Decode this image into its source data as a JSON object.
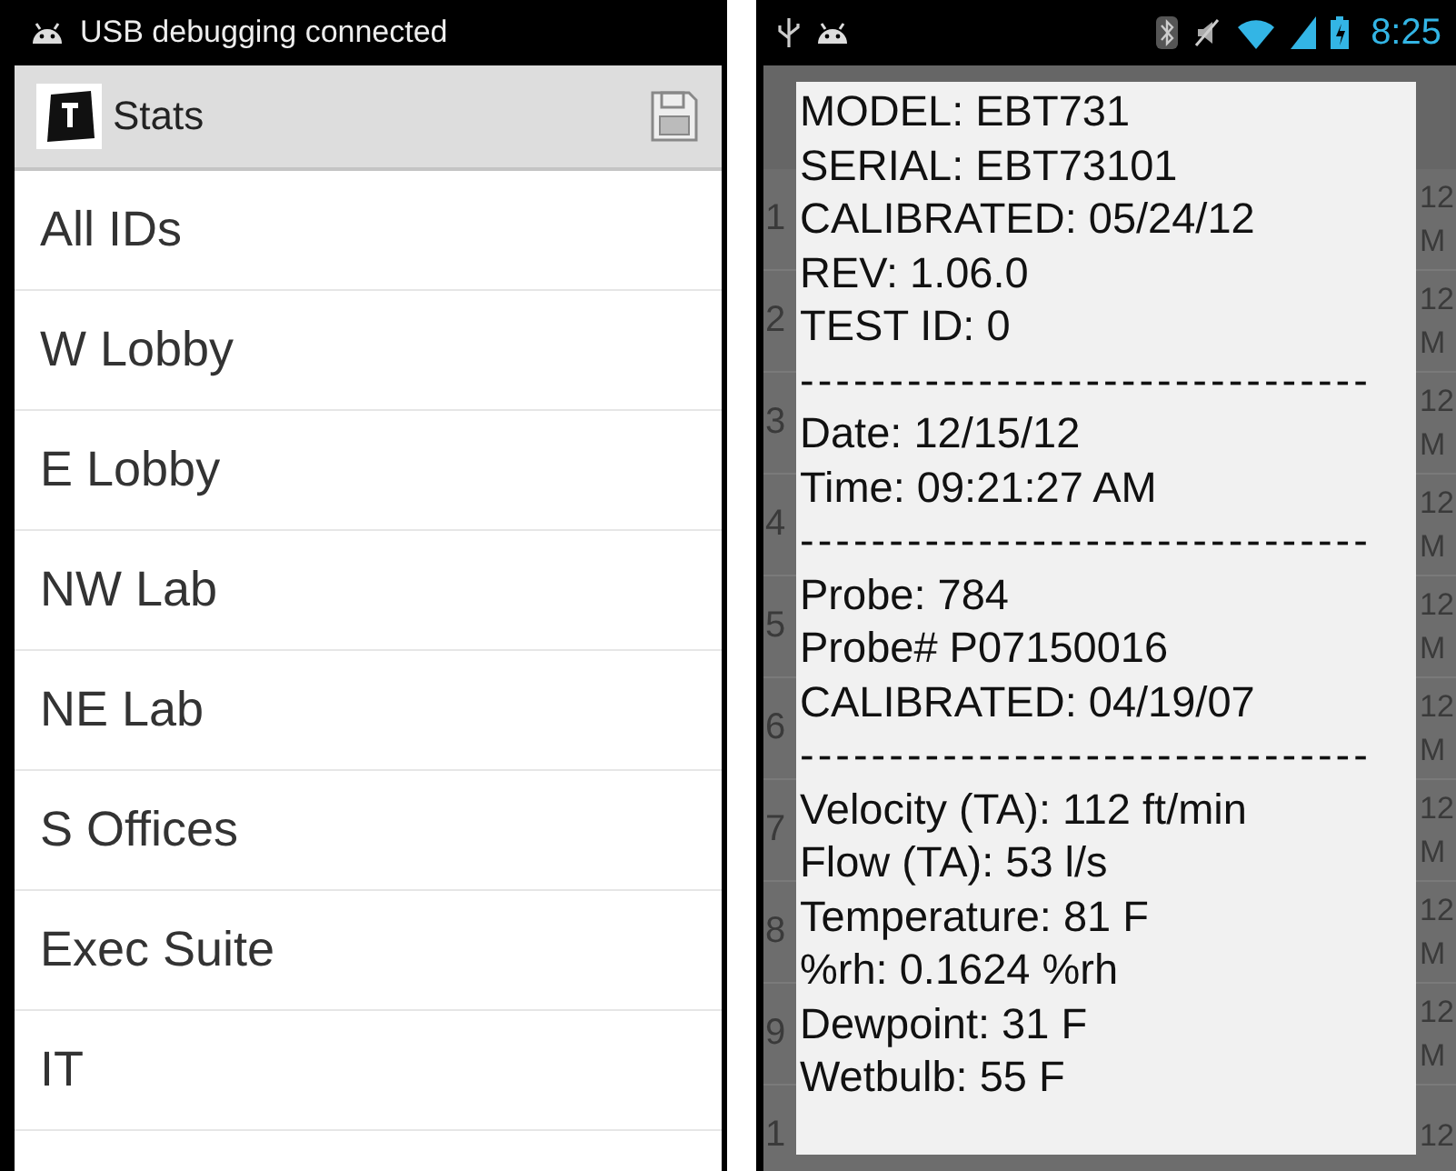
{
  "left_screen": {
    "status_bar": {
      "text": "USB debugging connected"
    },
    "action_bar": {
      "title": "Stats"
    },
    "items": [
      "All IDs",
      "W Lobby",
      "E Lobby",
      "NW Lab",
      "NE Lab",
      "S Offices",
      "Exec Suite",
      "IT"
    ]
  },
  "right_screen": {
    "status_bar": {
      "time": "8:25"
    },
    "background_rows": [
      {
        "index": "1",
        "line_1": "12",
        "line_2": "M"
      },
      {
        "index": "2",
        "line_1": "12",
        "line_2": "M"
      },
      {
        "index": "3",
        "line_1": "12",
        "line_2": "M"
      },
      {
        "index": "4",
        "line_1": "12",
        "line_2": "M"
      },
      {
        "index": "5",
        "line_1": "12",
        "line_2": "M"
      },
      {
        "index": "6",
        "line_1": "12",
        "line_2": "M"
      },
      {
        "index": "7",
        "line_1": "12",
        "line_2": "M"
      },
      {
        "index": "8",
        "line_1": "12",
        "line_2": "M"
      },
      {
        "index": "9",
        "line_1": "12",
        "line_2": "M"
      },
      {
        "index": "1",
        "line_1": "12",
        "line_2": ""
      }
    ],
    "dialog_lines": [
      {
        "kind": "text",
        "text": "MODEL: EBT731"
      },
      {
        "kind": "text",
        "text": "SERIAL: EBT73101"
      },
      {
        "kind": "text",
        "text": "CALIBRATED: 05/24/12"
      },
      {
        "kind": "text",
        "text": "REV: 1.06.0"
      },
      {
        "kind": "text",
        "text": "TEST ID: 0"
      },
      {
        "kind": "separator",
        "text": "--------------------------------"
      },
      {
        "kind": "text",
        "text": "Date: 12/15/12"
      },
      {
        "kind": "text",
        "text": "Time: 09:21:27 AM"
      },
      {
        "kind": "separator",
        "text": "--------------------------------"
      },
      {
        "kind": "text",
        "text": "Probe: 784"
      },
      {
        "kind": "text",
        "text": "Probe# P07150016"
      },
      {
        "kind": "text",
        "text": "CALIBRATED: 04/19/07"
      },
      {
        "kind": "separator",
        "text": "--------------------------------"
      },
      {
        "kind": "text",
        "text": "Velocity (TA): 112 ft/min"
      },
      {
        "kind": "text",
        "text": "Flow (TA): 53 l/s"
      },
      {
        "kind": "text",
        "text": "Temperature: 81 F"
      },
      {
        "kind": "text",
        "text": "%rh: 0.1624 %rh"
      },
      {
        "kind": "text",
        "text": "Dewpoint: 31 F"
      },
      {
        "kind": "text",
        "text": "Wetbulb: 55 F"
      }
    ]
  }
}
